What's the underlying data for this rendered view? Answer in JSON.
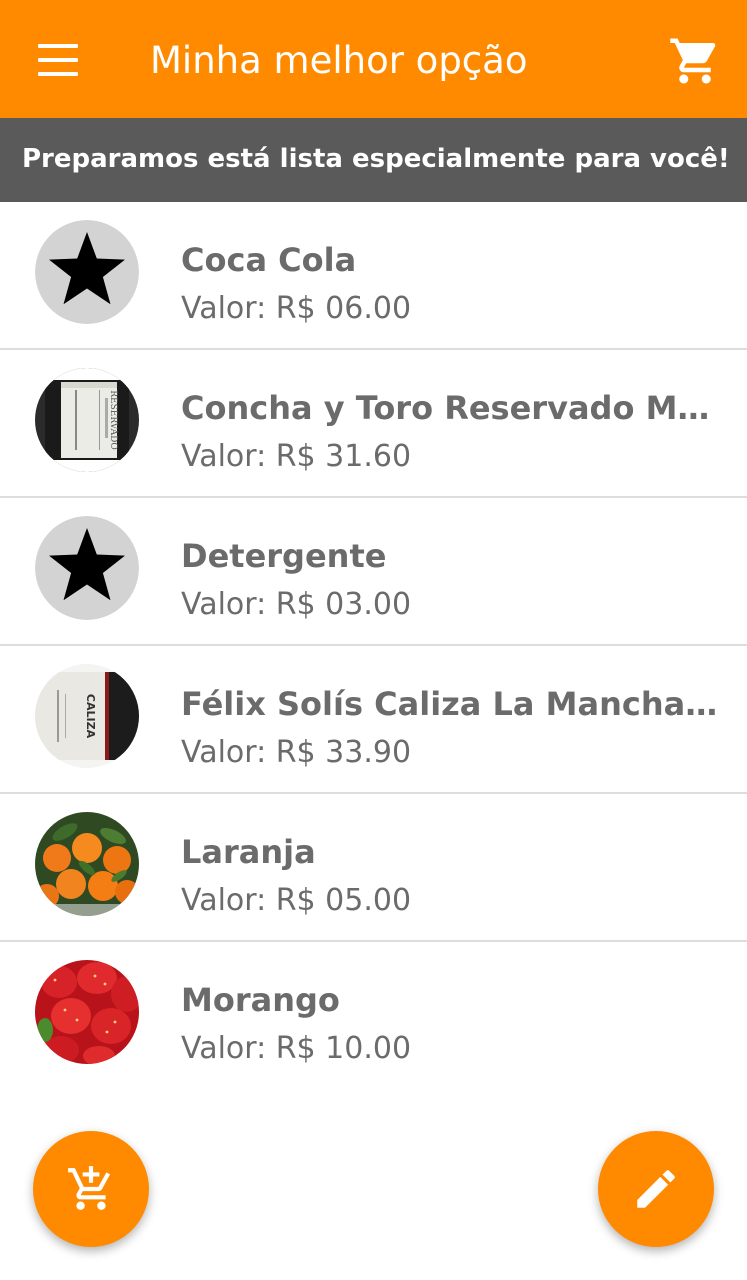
{
  "app_bar": {
    "title": "Minha melhor opção",
    "background": "#FF8A00",
    "menu_icon": "menu-icon",
    "cart_icon": "shopping-cart-icon"
  },
  "subheader": {
    "text": "Preparamos está lista especialmente para você!",
    "background": "#5A5A5A"
  },
  "products": [
    {
      "name": "Coca Cola",
      "price": "Valor: R$ 06.00",
      "image": "star-icon"
    },
    {
      "name": "Concha y Toro Reservado Merlot",
      "price": "Valor: R$ 31.60",
      "image": "wine-bottle-reservado"
    },
    {
      "name": "Detergente",
      "price": "Valor: R$ 03.00",
      "image": "star-icon"
    },
    {
      "name": "Félix Solís Caliza La Mancha D...",
      "price": "Valor: R$ 33.90",
      "image": "wine-bottle-caliza"
    },
    {
      "name": "Laranja",
      "price": "Valor: R$ 05.00",
      "image": "oranges-photo"
    },
    {
      "name": "Morango",
      "price": "Valor: R$ 10.00",
      "image": "strawberries-photo"
    }
  ],
  "fabs": {
    "add_to_cart_icon": "add-shopping-cart-icon",
    "edit_icon": "pencil-icon"
  }
}
